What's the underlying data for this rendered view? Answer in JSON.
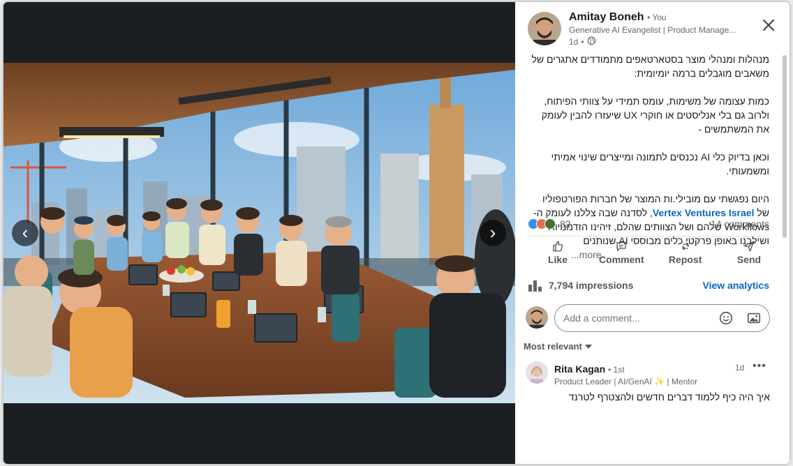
{
  "author": {
    "name": "Amitay Boneh",
    "you_badge": "You",
    "headline": "Generative AI Evangelist | Product Manage...",
    "time": "1d",
    "visibility_icon": "globe-icon"
  },
  "navigation": {
    "prev_glyph": "‹",
    "next_glyph": "›"
  },
  "post": {
    "p1": "מנהלות ומנהלי מוצר בסטארטאפים מתמודדים אתגרים של משאבים מוגבלים ברמה יומיומית:",
    "p2": "כמות עצומה של משימות, עומס תמידי על צוותי הפיתוח, ולרוב גם בלי אנליסטים או חוקרי UX שיעזרו להבין לעומק את המשתמשים -",
    "p3": "וכאן בדיוק כלי AI נכנסים לתמונה ומייצרים שינוי אמיתי ומשמעותי.",
    "p4_before": "היום נפגשתי עם מובילי.ות המוצר של חברות הפורטפוליו של ",
    "p4_link": "Vertex Ventures Israel",
    "p4_after": ", לסדנה שבה צללנו לעומק ה-Workflows שלהם ושל הצוותים שהלם, זיהינו הזדמנויות ושילבנו באופן פרקטי כלים מבוססי AI שנותנים",
    "more_label": "...more"
  },
  "social": {
    "reaction_count": "82",
    "comments_count": "14 comments",
    "reaction_colors": [
      "#378fe9",
      "#df704d",
      "#44712e"
    ]
  },
  "actions": [
    {
      "label": "Like",
      "icon": "like-icon"
    },
    {
      "label": "Comment",
      "icon": "comment-icon"
    },
    {
      "label": "Repost",
      "icon": "repost-icon"
    },
    {
      "label": "Send",
      "icon": "send-icon"
    }
  ],
  "analytics": {
    "impressions": "7,794 impressions",
    "view_label": "View analytics"
  },
  "compose": {
    "placeholder": "Add a comment..."
  },
  "comments": {
    "sort_label": "Most relevant",
    "items": [
      {
        "name": "Rita Kagan",
        "degree": "1st",
        "headline": "Product Leader | AI/GenAI ✨ | Mentor",
        "time": "1d",
        "text": "איך היה כיף ללמוד דברים חדשים ולהצטרף לטרנד"
      }
    ]
  },
  "colors": {
    "link": "#0a66c2",
    "viewer_bg": "#1b1f23"
  }
}
